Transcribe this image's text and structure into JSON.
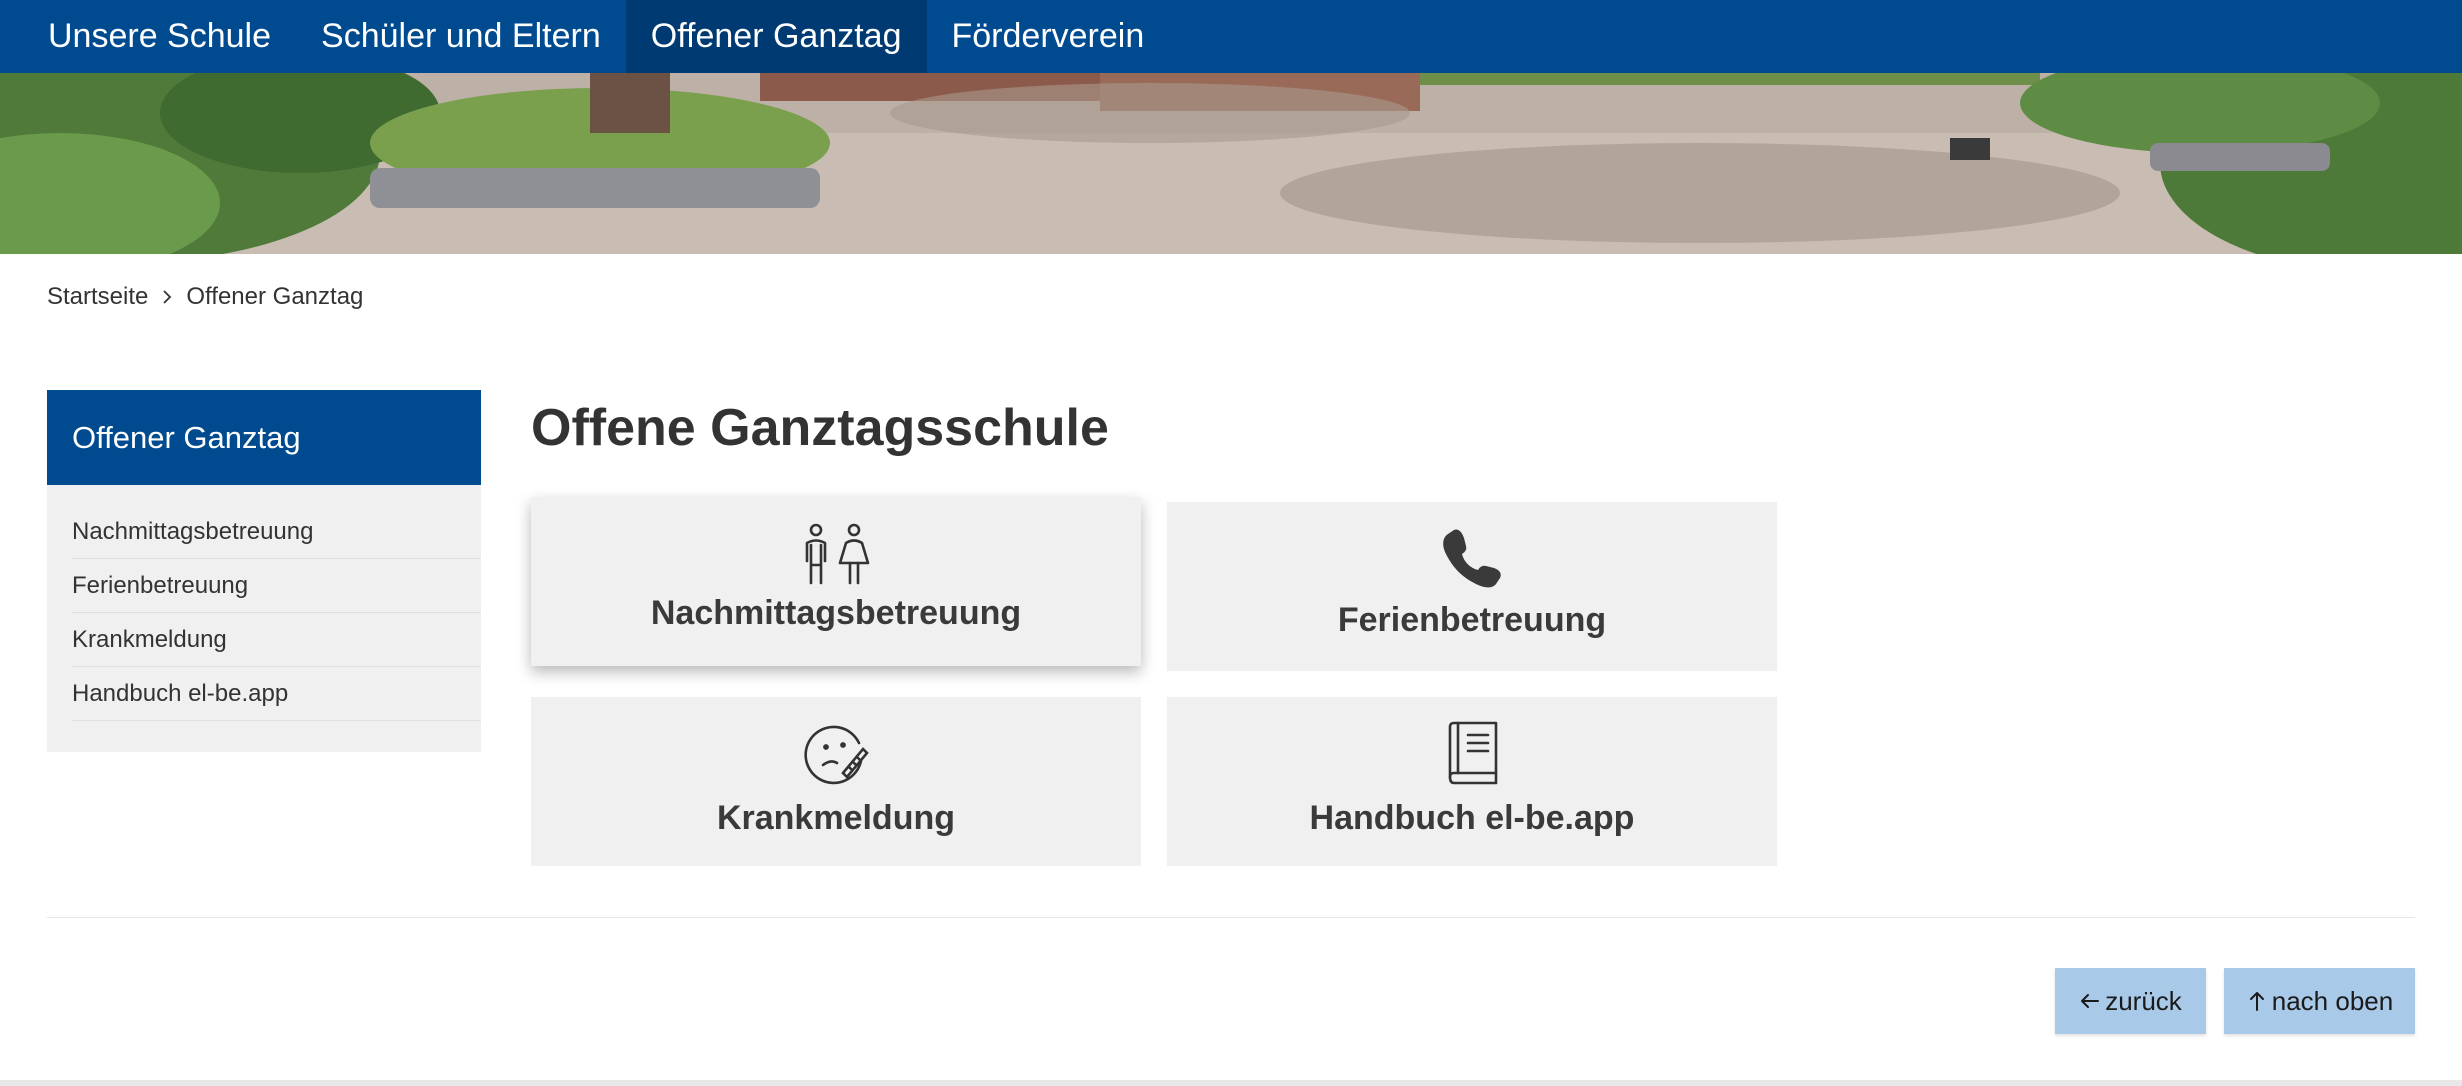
{
  "topnav": {
    "items": [
      {
        "label": "Unsere Schule",
        "active": false
      },
      {
        "label": "Schüler und Eltern",
        "active": false
      },
      {
        "label": "Offener Ganztag",
        "active": true
      },
      {
        "label": "Förderverein",
        "active": false
      }
    ]
  },
  "breadcrumb": {
    "home": "Startseite",
    "current": "Offener Ganztag"
  },
  "sidebar": {
    "title": "Offener Ganztag",
    "items": [
      {
        "label": "Nachmittagsbetreuung"
      },
      {
        "label": "Ferienbetreuung"
      },
      {
        "label": "Krankmeldung"
      },
      {
        "label": "Handbuch el-be.app"
      }
    ]
  },
  "main": {
    "title": "Offene Ganztagsschule",
    "tiles": [
      {
        "label": "Nachmittagsbetreuung",
        "icon": "children-icon"
      },
      {
        "label": "Ferienbetreuung",
        "icon": "phone-icon"
      },
      {
        "label": "Krankmeldung",
        "icon": "sick-face-thermometer-icon"
      },
      {
        "label": "Handbuch el-be.app",
        "icon": "book-icon"
      }
    ]
  },
  "footer": {
    "back_label": "zurück",
    "top_label": "nach oben"
  },
  "colors": {
    "primary": "#004a8f",
    "primary_active": "#003a72",
    "tile_bg": "#f0f0f0",
    "button_bg": "#a9c9e9"
  }
}
